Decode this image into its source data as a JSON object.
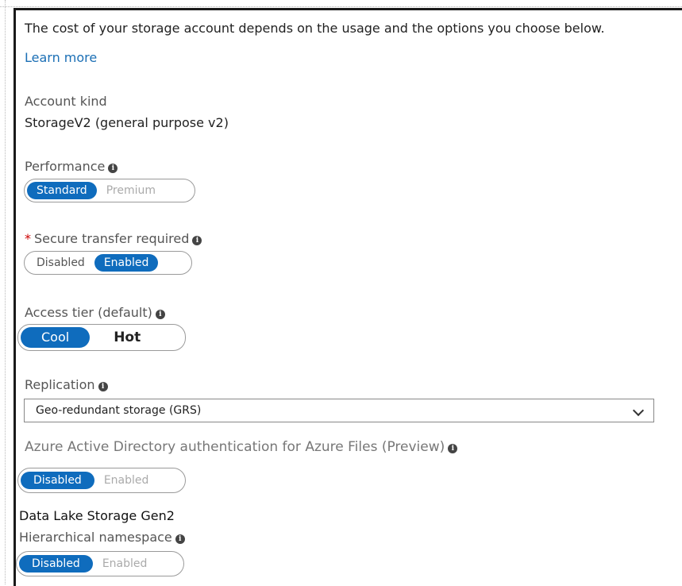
{
  "intro": {
    "text": "The cost of your storage account depends on the usage and the options you choose below.",
    "learn_more": "Learn more"
  },
  "account_kind": {
    "label": "Account kind",
    "value": "StorageV2 (general purpose v2)"
  },
  "performance": {
    "label": "Performance",
    "options": [
      "Standard",
      "Premium"
    ],
    "selected": "Standard"
  },
  "secure_transfer": {
    "required_mark": "*",
    "label": "Secure transfer required",
    "options": [
      "Disabled",
      "Enabled"
    ],
    "selected": "Enabled"
  },
  "access_tier": {
    "label": "Access tier (default)",
    "options": [
      "Cool",
      "Hot"
    ],
    "selected": "Cool"
  },
  "replication": {
    "label": "Replication",
    "value": "Geo-redundant storage (GRS)"
  },
  "aad_auth": {
    "label": "Azure Active Directory authentication for Azure Files (Preview)",
    "options": [
      "Disabled",
      "Enabled"
    ],
    "selected": "Disabled"
  },
  "data_lake": {
    "section_title": "Data Lake Storage Gen2",
    "label": "Hierarchical namespace",
    "options": [
      "Disabled",
      "Enabled"
    ],
    "selected": "Disabled"
  },
  "colors": {
    "accent": "#0f6cbd",
    "link": "#1b6fb5",
    "required": "#cc0000"
  },
  "icons": {
    "info": "info-icon",
    "dropdown": "chevron-down-icon"
  }
}
